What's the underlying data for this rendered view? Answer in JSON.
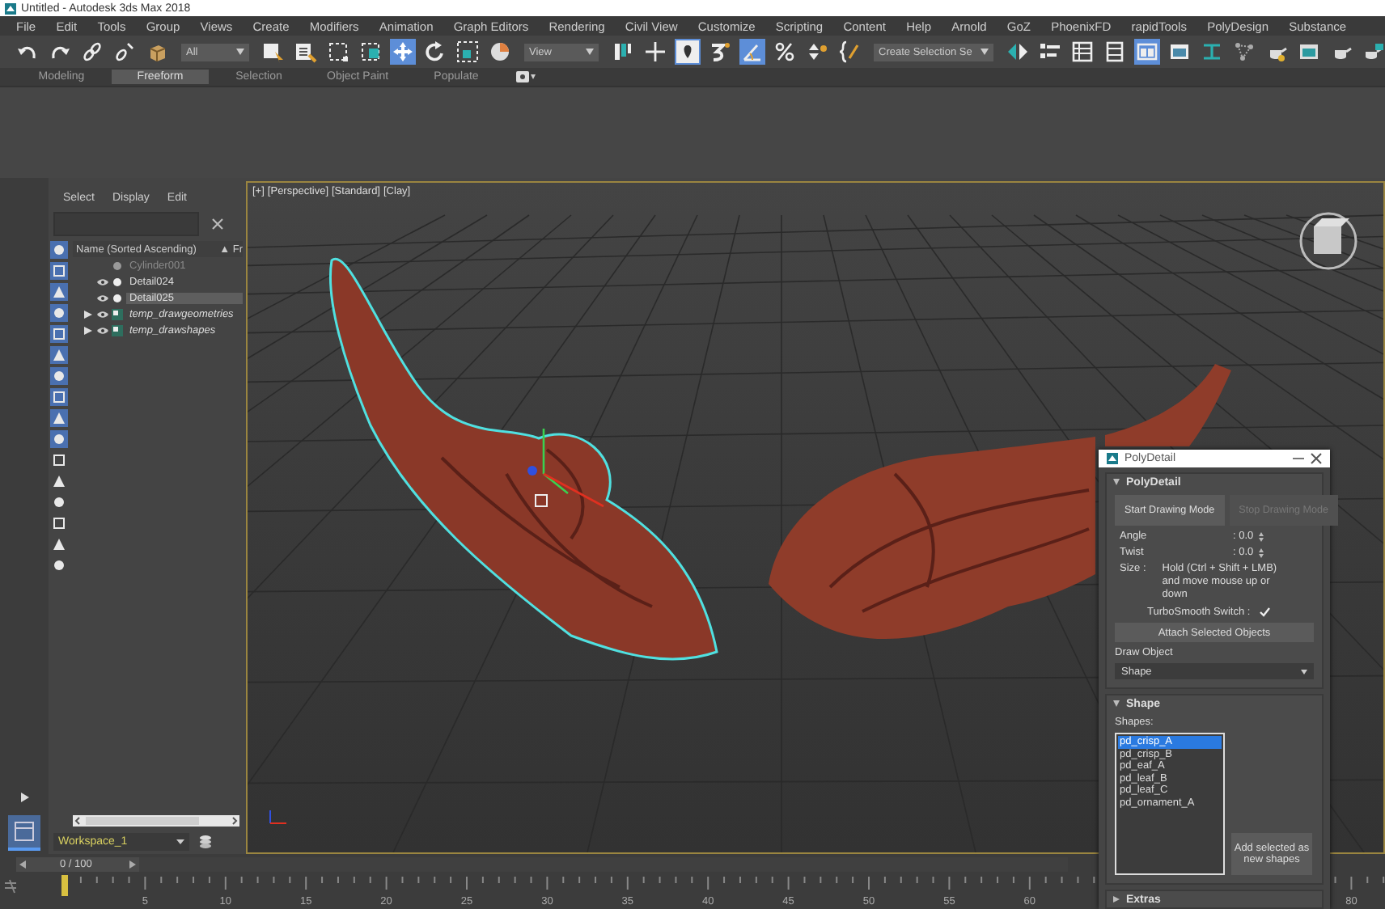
{
  "window": {
    "title": "Untitled - Autodesk 3ds Max 2018"
  },
  "menu": [
    "File",
    "Edit",
    "Tools",
    "Group",
    "Views",
    "Create",
    "Modifiers",
    "Animation",
    "Graph Editors",
    "Rendering",
    "Civil View",
    "Customize",
    "Scripting",
    "Content",
    "Help",
    "Arnold",
    "GoZ",
    "PhoenixFD",
    "rapidTools",
    "PolyDesign",
    "Substance"
  ],
  "toolbar": [
    {
      "kind": "icon",
      "selected": false
    },
    {
      "kind": "icon",
      "selected": false
    },
    {
      "kind": "icon",
      "selected": false
    },
    {
      "kind": "icon",
      "selected": false
    },
    {
      "kind": "icon",
      "selected": false
    },
    {
      "kind": "dropdown",
      "value": "All"
    },
    {
      "kind": "icon",
      "selected": false
    },
    {
      "kind": "icon",
      "selected": false
    },
    {
      "kind": "icon",
      "selected": false
    },
    {
      "kind": "icon",
      "selected": false
    },
    {
      "kind": "icon",
      "selected": true
    },
    {
      "kind": "icon",
      "selected": false
    },
    {
      "kind": "icon",
      "selected": false
    },
    {
      "kind": "icon",
      "selected": false
    },
    {
      "kind": "dropdown",
      "value": "View"
    },
    {
      "kind": "icon",
      "selected": false
    },
    {
      "kind": "icon",
      "selected": false
    },
    {
      "kind": "icon",
      "selected": true
    },
    {
      "kind": "icon",
      "selected": false
    },
    {
      "kind": "icon",
      "selected": true
    },
    {
      "kind": "icon",
      "selected": false
    },
    {
      "kind": "icon",
      "selected": false
    },
    {
      "kind": "icon",
      "selected": false
    },
    {
      "kind": "dropdown",
      "value": "Create Selection Se"
    },
    {
      "kind": "icon",
      "selected": false
    },
    {
      "kind": "icon",
      "selected": false
    },
    {
      "kind": "icon",
      "selected": false
    },
    {
      "kind": "icon",
      "selected": false
    },
    {
      "kind": "icon",
      "selected": true
    },
    {
      "kind": "icon",
      "selected": false
    },
    {
      "kind": "icon",
      "selected": false
    },
    {
      "kind": "icon",
      "selected": false
    },
    {
      "kind": "icon",
      "selected": false
    },
    {
      "kind": "icon",
      "selected": false
    },
    {
      "kind": "icon",
      "selected": false
    },
    {
      "kind": "icon",
      "selected": false
    }
  ],
  "ribbon": {
    "tabs": [
      {
        "label": "Modeling",
        "selected": false
      },
      {
        "label": "Freeform",
        "selected": true
      },
      {
        "label": "Selection",
        "selected": false
      },
      {
        "label": "Object Paint",
        "selected": false
      },
      {
        "label": "Populate",
        "selected": false
      }
    ]
  },
  "scene_explorer": {
    "menu": [
      "Select",
      "Display",
      "Edit"
    ],
    "columns": [
      "Name (Sorted Ascending)",
      "▲ Fr"
    ],
    "rows": [
      {
        "kind": "object",
        "name": "Cylinder001",
        "visible": false,
        "selected": false
      },
      {
        "kind": "object",
        "name": "Detail024",
        "visible": true,
        "selected": false
      },
      {
        "kind": "object",
        "name": "Detail025",
        "visible": true,
        "selected": true
      },
      {
        "kind": "layer",
        "name": "temp_drawgeometries",
        "visible": true,
        "selected": false,
        "expanded": false
      },
      {
        "kind": "layer",
        "name": "temp_drawshapes",
        "visible": true,
        "selected": false,
        "expanded": false
      }
    ],
    "workspace": "Workspace_1"
  },
  "viewport": {
    "labels": [
      "[+]",
      "[Perspective]",
      "[Standard]",
      "[Clay]"
    ]
  },
  "poly_detail": {
    "title": "PolyDetail",
    "main": {
      "title": "PolyDetail",
      "buttons": [
        {
          "label": "Start Drawing Mode",
          "disabled": false
        },
        {
          "label": "Stop Drawing Mode",
          "disabled": true
        }
      ],
      "spinners": [
        {
          "label": "Angle",
          "value": ": 0.0"
        },
        {
          "label": "Twist",
          "value": ": 0.0"
        }
      ],
      "size_label": "Size :",
      "size_hint": "Hold (Ctrl + Shift + LMB) and move mouse up or down",
      "turbosmooth": {
        "label": "TurboSmooth Switch :",
        "checked": true
      },
      "attach_button": "Attach Selected Objects",
      "draw_object": {
        "label": "Draw Object",
        "value": "Shape"
      }
    },
    "shape": {
      "title": "Shape",
      "list_label": "Shapes:",
      "items": [
        {
          "label": "pd_crisp_A",
          "selected": true
        },
        {
          "label": "pd_crisp_B",
          "selected": false
        },
        {
          "label": "pd_eaf_A",
          "selected": false
        },
        {
          "label": "pd_leaf_B",
          "selected": false
        },
        {
          "label": "pd_leaf_C",
          "selected": false
        },
        {
          "label": "pd_ornament_A",
          "selected": false
        }
      ],
      "add_button": "Add selected as new shapes"
    },
    "extras": {
      "title": "Extras"
    }
  },
  "time_slider": {
    "reading": "0 / 100",
    "level": 0
  },
  "track": {
    "labels": [
      "5",
      "10",
      "15",
      "20",
      "25",
      "30",
      "35",
      "40",
      "45",
      "50",
      "55",
      "60"
    ],
    "end_label": "80"
  }
}
